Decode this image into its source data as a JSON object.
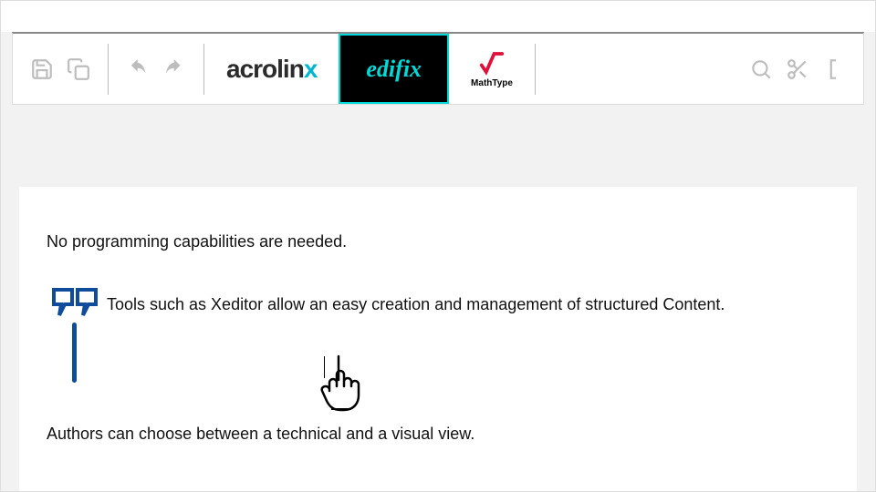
{
  "toolbar": {
    "brands": {
      "acrolinx": "acrolin",
      "acrolinx_suffix": "x",
      "edifix": "edifix",
      "mathtype": "MathType"
    }
  },
  "content": {
    "para1": "No programming capabilities are needed.",
    "quote": "Tools such as Xeditor allow an easy creation and management of structured Content.",
    "para2": "Authors can choose between a technical and a visual view."
  }
}
